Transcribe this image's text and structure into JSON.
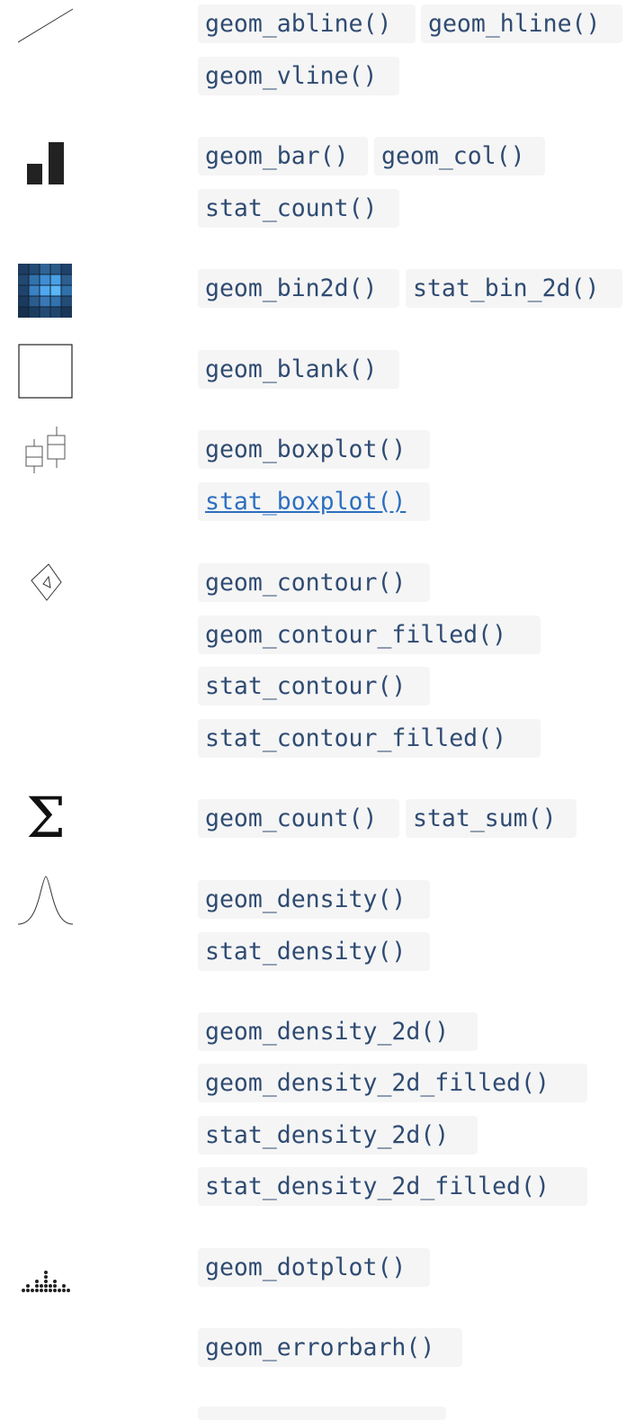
{
  "rows": [
    {
      "id": "abline",
      "icon": "diagonal-line-icon",
      "functions": [
        "geom_abline()",
        "geom_hline()",
        "geom_vline()"
      ]
    },
    {
      "id": "bar",
      "icon": "bar-chart-icon",
      "functions": [
        "geom_bar()",
        "geom_col()",
        "stat_count()"
      ]
    },
    {
      "id": "bin2d",
      "icon": "heatmap-grid-icon",
      "functions": [
        "geom_bin2d()",
        "stat_bin_2d()"
      ]
    },
    {
      "id": "blank",
      "icon": "blank-square-icon",
      "functions": [
        "geom_blank()"
      ]
    },
    {
      "id": "boxplot",
      "icon": "boxplot-icon",
      "functions": [
        "geom_boxplot()",
        "stat_boxplot()"
      ]
    },
    {
      "id": "contour",
      "icon": "contour-icon",
      "functions": [
        "geom_contour()",
        "geom_contour_filled()",
        "stat_contour()",
        "stat_contour_filled()"
      ]
    },
    {
      "id": "count",
      "icon": "sigma-icon",
      "icon_glyph": "Σ",
      "functions": [
        "geom_count()",
        "stat_sum()"
      ]
    },
    {
      "id": "density",
      "icon": "bell-curve-icon",
      "functions": [
        "geom_density()",
        "stat_density()"
      ]
    },
    {
      "id": "density2d",
      "icon": "",
      "functions": [
        "geom_density_2d()",
        "geom_density_2d_filled()",
        "stat_density_2d()",
        "stat_density_2d_filled()"
      ]
    },
    {
      "id": "dotplot",
      "icon": "dotplot-icon",
      "functions": [
        "geom_dotplot()"
      ]
    },
    {
      "id": "errorbarh",
      "icon": "",
      "functions": [
        "geom_errorbarh()"
      ]
    }
  ],
  "colors": {
    "chip_bg": "#f5f5f5",
    "code_text": "#2f4b72",
    "link_text": "#2c6fbf"
  }
}
